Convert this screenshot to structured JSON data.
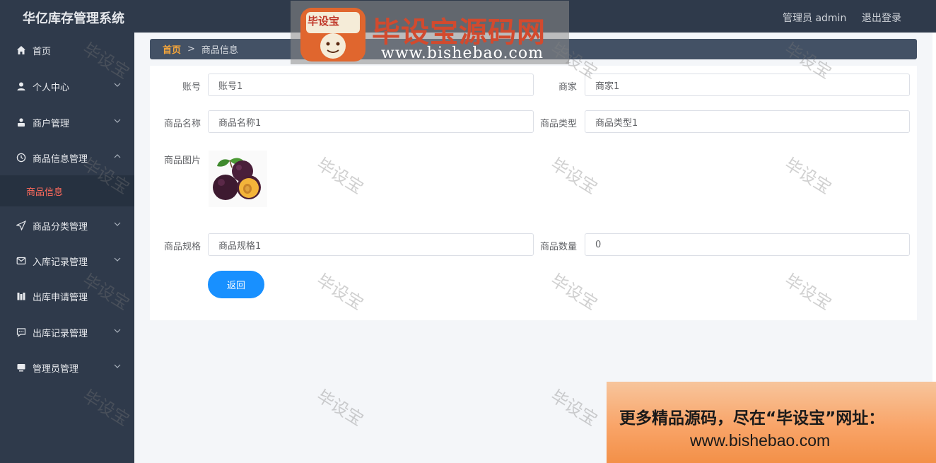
{
  "header": {
    "app_title": "华亿库存管理系统",
    "user_label": "管理员 admin",
    "logout_label": "退出登录"
  },
  "sidebar": {
    "items": [
      {
        "label": "首页",
        "icon": "home-icon"
      },
      {
        "label": "个人中心",
        "icon": "user-icon"
      },
      {
        "label": "商户管理",
        "icon": "merchant-icon"
      },
      {
        "label": "商品信息管理",
        "icon": "clock-icon"
      },
      {
        "label": "商品分类管理",
        "icon": "send-icon"
      },
      {
        "label": "入库记录管理",
        "icon": "mail-icon"
      },
      {
        "label": "出库申请管理",
        "icon": "chart-icon"
      },
      {
        "label": "出库记录管理",
        "icon": "chat-icon"
      },
      {
        "label": "管理员管理",
        "icon": "monitor-icon"
      }
    ],
    "active_sub": "商品信息"
  },
  "breadcrumb": {
    "home": "首页",
    "separator": ">",
    "current": "商品信息"
  },
  "form": {
    "account_label": "账号",
    "account_value": "账号1",
    "merchant_label": "商家",
    "merchant_value": "商家1",
    "name_label": "商品名称",
    "name_value": "商品名称1",
    "type_label": "商品类型",
    "type_value": "商品类型1",
    "image_label": "商品图片",
    "spec_label": "商品规格",
    "spec_value": "商品规格1",
    "qty_label": "商品数量",
    "qty_value": "0",
    "back_button": "返回"
  },
  "watermark": {
    "text": "毕设宝",
    "logo_badge": "毕设宝",
    "logo_title": "毕设宝源码网",
    "logo_url": "www.bishebao.com",
    "promo_line1": "更多精品源码，尽在“毕设宝”网址：",
    "promo_line2": "www.bishebao.com"
  },
  "colors": {
    "sidebar_bg": "#2f3a4b",
    "active_sub": "#ff6a5c",
    "breadcrumb_home": "#f6a63a",
    "primary_button": "#1890ff"
  }
}
